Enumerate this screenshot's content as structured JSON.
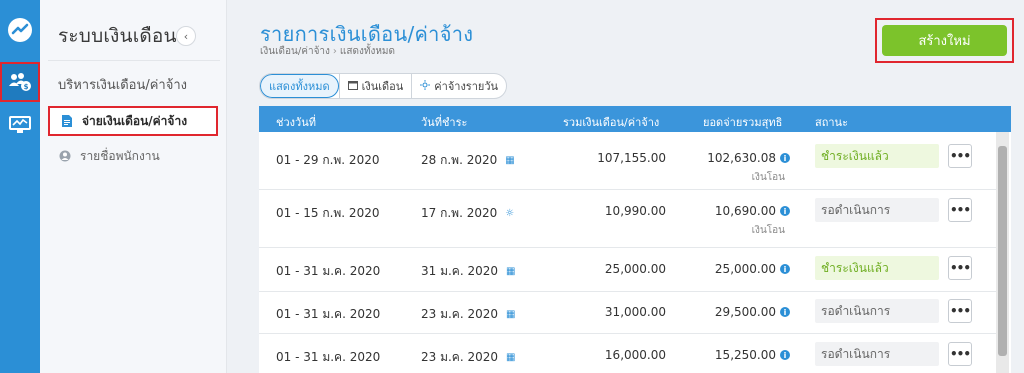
{
  "rail": {
    "icons": [
      "app-logo-icon",
      "payroll-users-icon",
      "monitor-chart-icon"
    ]
  },
  "sidebar": {
    "title": "ระบบเงินเดือน",
    "collapse_glyph": "‹",
    "section_label": "บริหารเงินเดือน/ค่าจ้าง",
    "items": [
      {
        "label": "จ่ายเงินเดือน/ค่าจ้าง",
        "icon": "document-icon",
        "active": true
      },
      {
        "label": "รายชื่อพนักงาน",
        "icon": "user-circle-icon",
        "active": false
      }
    ]
  },
  "header": {
    "title": "รายการเงินเดือน/ค่าจ้าง",
    "breadcrumb": [
      "เงินเดือน/ค่าจ้าง",
      "แสดงทั้งหมด"
    ],
    "create_label": "สร้างใหม่"
  },
  "filters": [
    {
      "label": "แสดงทั้งหมด",
      "icon": "",
      "active": true
    },
    {
      "label": "เงินเดือน",
      "icon": "calendar-icon",
      "active": false
    },
    {
      "label": "ค่าจ้างรายวัน",
      "icon": "sun-icon",
      "active": false
    }
  ],
  "table": {
    "columns": [
      "ช่วงวันที่",
      "วันที่ชำระ",
      "รวมเงินเดือน/ค่าจ้าง",
      "ยอดจ่ายรวมสุทธิ",
      "สถานะ"
    ],
    "rows": [
      {
        "period": "01 - 29 ก.พ. 2020",
        "pay_date": "28 ก.พ. 2020",
        "date_icon": "calendar-icon",
        "total": "107,155.00",
        "net": "102,630.08",
        "sub": "เงินโอน",
        "status": "ชำระเงินแล้ว",
        "status_type": "paid"
      },
      {
        "period": "01 - 15 ก.พ. 2020",
        "pay_date": "17 ก.พ. 2020",
        "date_icon": "sun-icon",
        "total": "10,990.00",
        "net": "10,690.00",
        "sub": "เงินโอน",
        "status": "รอดำเนินการ",
        "status_type": "pending"
      },
      {
        "period": "01 - 31 ม.ค. 2020",
        "pay_date": "31 ม.ค. 2020",
        "date_icon": "calendar-icon",
        "total": "25,000.00",
        "net": "25,000.00",
        "sub": "",
        "status": "ชำระเงินแล้ว",
        "status_type": "paid"
      },
      {
        "period": "01 - 31 ม.ค. 2020",
        "pay_date": "23 ม.ค. 2020",
        "date_icon": "calendar-icon",
        "total": "31,000.00",
        "net": "29,500.00",
        "sub": "",
        "status": "รอดำเนินการ",
        "status_type": "pending"
      },
      {
        "period": "01 - 31 ม.ค. 2020",
        "pay_date": "23 ม.ค. 2020",
        "date_icon": "calendar-icon",
        "total": "16,000.00",
        "net": "15,250.00",
        "sub": "",
        "status": "รอดำเนินการ",
        "status_type": "pending"
      }
    ],
    "more_glyph": "•••"
  },
  "colors": {
    "primary": "#2b8fd6",
    "create": "#7cc32b",
    "paid_text": "#6fae22",
    "highlight_box": "#e0262e"
  }
}
